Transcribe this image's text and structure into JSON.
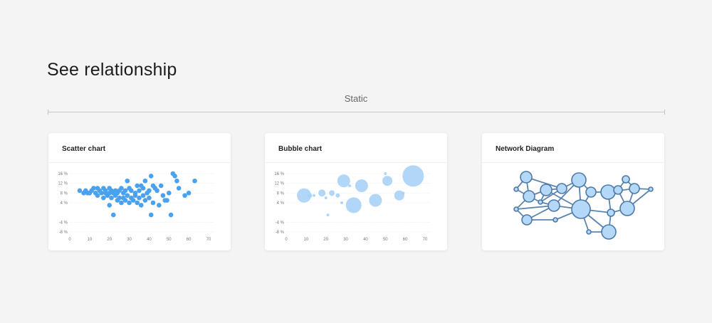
{
  "page": {
    "heading": "See relationship",
    "section_label": "Static"
  },
  "cards": [
    {
      "title": "Scatter chart"
    },
    {
      "title": "Bubble chart"
    },
    {
      "title": "Network Diagram"
    }
  ],
  "colors": {
    "scatter_point": "#4aa2ee",
    "bubble_fill": "#a9d2f7",
    "node_fill": "#b4d8f7",
    "node_stroke": "#4d79a8",
    "edge": "#5b84ae",
    "grid": "#e6e6e6"
  },
  "chart_data": [
    {
      "type": "scatter",
      "title": "Scatter chart",
      "xlim": [
        0,
        70
      ],
      "ylim": [
        -8,
        16
      ],
      "x_ticks": [
        "0",
        "10",
        "20",
        "30",
        "40",
        "50",
        "60",
        "70"
      ],
      "y_ticks": [
        "16 %",
        "12 %",
        "8 %",
        "4 %",
        "-4 %",
        "-8 %"
      ],
      "grid": true,
      "points": [
        [
          5,
          9
        ],
        [
          7,
          8
        ],
        [
          8,
          9
        ],
        [
          9,
          8
        ],
        [
          10,
          8
        ],
        [
          11,
          9
        ],
        [
          12,
          10
        ],
        [
          13,
          8
        ],
        [
          14,
          7
        ],
        [
          14,
          10
        ],
        [
          15,
          9
        ],
        [
          16,
          8
        ],
        [
          17,
          10
        ],
        [
          17,
          6
        ],
        [
          18,
          9
        ],
        [
          18,
          8
        ],
        [
          19,
          7
        ],
        [
          20,
          8
        ],
        [
          20,
          10
        ],
        [
          20,
          3
        ],
        [
          21,
          9
        ],
        [
          21,
          6
        ],
        [
          22,
          8
        ],
        [
          22,
          -1
        ],
        [
          23,
          9
        ],
        [
          23,
          7
        ],
        [
          24,
          8
        ],
        [
          24,
          5
        ],
        [
          25,
          9
        ],
        [
          25,
          6
        ],
        [
          26,
          4
        ],
        [
          26,
          10
        ],
        [
          27,
          8
        ],
        [
          27,
          6
        ],
        [
          28,
          5
        ],
        [
          28,
          9
        ],
        [
          29,
          7
        ],
        [
          29,
          13
        ],
        [
          30,
          10
        ],
        [
          30,
          4
        ],
        [
          31,
          6
        ],
        [
          31,
          9
        ],
        [
          32,
          5
        ],
        [
          33,
          8
        ],
        [
          33,
          7
        ],
        [
          34,
          11
        ],
        [
          34,
          4
        ],
        [
          35,
          9
        ],
        [
          35,
          6
        ],
        [
          36,
          11
        ],
        [
          36,
          3
        ],
        [
          37,
          10
        ],
        [
          37,
          7
        ],
        [
          38,
          13
        ],
        [
          38,
          5
        ],
        [
          39,
          8
        ],
        [
          40,
          9
        ],
        [
          40,
          6
        ],
        [
          41,
          15
        ],
        [
          41,
          -1
        ],
        [
          42,
          11
        ],
        [
          42,
          4
        ],
        [
          43,
          10
        ],
        [
          44,
          9
        ],
        [
          45,
          3
        ],
        [
          46,
          11
        ],
        [
          47,
          7
        ],
        [
          48,
          5
        ],
        [
          49,
          5
        ],
        [
          50,
          8
        ],
        [
          51,
          -1
        ],
        [
          52,
          16
        ],
        [
          53,
          15
        ],
        [
          54,
          13
        ],
        [
          55,
          10
        ],
        [
          58,
          7
        ],
        [
          60,
          8
        ],
        [
          63,
          13
        ]
      ]
    },
    {
      "type": "bubble",
      "title": "Bubble chart",
      "xlim": [
        0,
        70
      ],
      "ylim": [
        -8,
        16
      ],
      "x_ticks": [
        "0",
        "10",
        "20",
        "30",
        "40",
        "50",
        "60",
        "70"
      ],
      "y_ticks": [
        "16 %",
        "12 %",
        "8 %",
        "4 %",
        "-4 %",
        "-8 %"
      ],
      "grid": true,
      "points": [
        [
          9,
          7,
          10
        ],
        [
          12,
          7,
          3
        ],
        [
          14,
          7,
          2
        ],
        [
          18,
          8,
          5
        ],
        [
          20,
          6,
          2
        ],
        [
          21,
          -1,
          2
        ],
        [
          23,
          8,
          4
        ],
        [
          26,
          7,
          3
        ],
        [
          28,
          4,
          2
        ],
        [
          29,
          13,
          9
        ],
        [
          32,
          11,
          2
        ],
        [
          34,
          3,
          11
        ],
        [
          38,
          11,
          9
        ],
        [
          45,
          5,
          9
        ],
        [
          50,
          16,
          2
        ],
        [
          51,
          13,
          7
        ],
        [
          57,
          7,
          7
        ],
        [
          59,
          8,
          2
        ],
        [
          64,
          15,
          15
        ]
      ]
    }
  ],
  "network": {
    "nodes": [
      [
        48,
        10,
        8
      ],
      [
        34,
        27,
        3
      ],
      [
        52,
        37,
        8
      ],
      [
        76,
        28,
        8
      ],
      [
        98,
        26,
        7
      ],
      [
        122,
        14,
        10
      ],
      [
        139,
        31,
        7
      ],
      [
        68,
        45,
        3
      ],
      [
        87,
        50,
        8
      ],
      [
        34,
        55,
        3
      ],
      [
        49,
        70,
        7
      ],
      [
        89,
        70,
        3
      ],
      [
        125,
        55,
        13
      ],
      [
        136,
        87,
        3
      ],
      [
        164,
        87,
        10
      ],
      [
        163,
        31,
        10
      ],
      [
        177,
        28,
        6
      ],
      [
        188,
        13,
        5
      ],
      [
        200,
        26,
        7
      ],
      [
        223,
        27,
        3
      ],
      [
        167,
        60,
        5
      ],
      [
        190,
        54,
        10
      ]
    ],
    "edges": [
      [
        0,
        1
      ],
      [
        0,
        2
      ],
      [
        1,
        2
      ],
      [
        0,
        4
      ],
      [
        2,
        3
      ],
      [
        3,
        4
      ],
      [
        4,
        5
      ],
      [
        4,
        7
      ],
      [
        3,
        7
      ],
      [
        7,
        8
      ],
      [
        5,
        8
      ],
      [
        5,
        12
      ],
      [
        3,
        12
      ],
      [
        8,
        12
      ],
      [
        8,
        9
      ],
      [
        8,
        10
      ],
      [
        9,
        10
      ],
      [
        10,
        11
      ],
      [
        11,
        12
      ],
      [
        12,
        13
      ],
      [
        12,
        14
      ],
      [
        13,
        14
      ],
      [
        12,
        20
      ],
      [
        14,
        20
      ],
      [
        6,
        12
      ],
      [
        5,
        6
      ],
      [
        6,
        15
      ],
      [
        15,
        16
      ],
      [
        16,
        17
      ],
      [
        17,
        18
      ],
      [
        15,
        18
      ],
      [
        18,
        19
      ],
      [
        18,
        21
      ],
      [
        15,
        20
      ],
      [
        20,
        21
      ],
      [
        21,
        19
      ],
      [
        16,
        21
      ],
      [
        2,
        7
      ],
      [
        2,
        9
      ]
    ]
  }
}
